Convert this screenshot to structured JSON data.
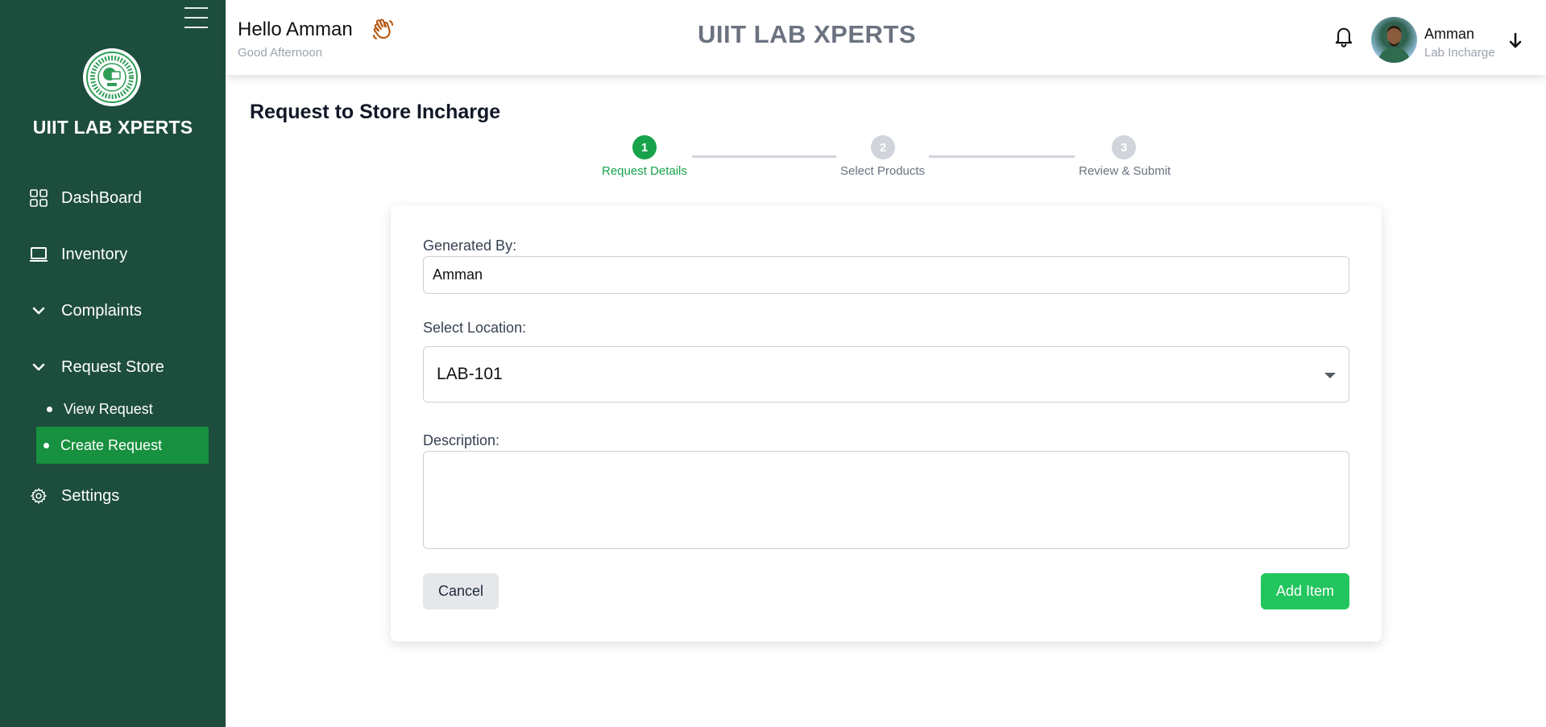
{
  "sidebar": {
    "brand": "UIIT LAB XPERTS",
    "items": [
      {
        "label": "DashBoard",
        "icon": "grid-icon"
      },
      {
        "label": "Inventory",
        "icon": "laptop-icon"
      },
      {
        "label": "Complaints",
        "icon": "chevron-down-icon"
      },
      {
        "label": "Request Store",
        "icon": "chevron-down-icon"
      },
      {
        "label": "Settings",
        "icon": "gear-icon"
      }
    ],
    "sub_items": [
      {
        "label": "View Request",
        "active": false
      },
      {
        "label": "Create Request",
        "active": true
      }
    ],
    "colors": {
      "background": "#1d4d3c",
      "active": "#17903f"
    }
  },
  "header": {
    "greeting": "Hello Amman",
    "sub_greeting": "Good Afternoon",
    "title": "UIIT LAB XPERTS",
    "user": {
      "name": "Amman",
      "role": "Lab Incharge"
    }
  },
  "main": {
    "page_title": "Request to Store Incharge",
    "steps": [
      {
        "number": "1",
        "label": "Request Details",
        "active": true
      },
      {
        "number": "2",
        "label": "Select Products",
        "active": false
      },
      {
        "number": "3",
        "label": "Review & Submit",
        "active": false
      }
    ],
    "form": {
      "generated_by_label": "Generated By:",
      "generated_by_value": "Amman",
      "location_label": "Select Location:",
      "location_value": "LAB-101",
      "description_label": "Description:",
      "description_value": "",
      "cancel_label": "Cancel",
      "add_label": "Add Item"
    },
    "colors": {
      "accent": "#16a34a",
      "button_primary": "#22c55e",
      "inactive_step": "#d1d5db"
    }
  }
}
